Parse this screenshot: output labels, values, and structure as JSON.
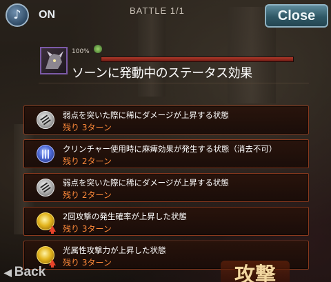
{
  "topbar": {
    "music_icon": "♪",
    "music_state": "ON",
    "battle_label": "BATTLE  1/1",
    "close_label": "Close"
  },
  "header": {
    "hp_percent": "100%",
    "hp_fraction": 1.0,
    "title": "ソーンに発動中のステータス効果"
  },
  "status_effects": [
    {
      "icon": "weakness-crit-icon",
      "description": "弱点を突いた際に稀にダメージが上昇する状態",
      "turns": "残り 3ターン"
    },
    {
      "icon": "paralysis-icon",
      "description": "クリンチャー使用時に麻痺効果が発生する状態（消去不可）",
      "turns": "残り 2ターン"
    },
    {
      "icon": "weakness-crit-icon",
      "description": "弱点を突いた際に稀にダメージが上昇する状態",
      "turns": "残り 2ターン"
    },
    {
      "icon": "double-attack-up-icon",
      "description": "2回攻撃の発生確率が上昇した状態",
      "turns": "残り 3ターン"
    },
    {
      "icon": "light-attack-up-icon",
      "description": "光属性攻撃力が上昇した状態",
      "turns": "残り 3ターン"
    }
  ],
  "bottom": {
    "back_label": "Back",
    "attack_label": "攻撃"
  },
  "colors": {
    "turns_text": "#ff8a3a",
    "item_border": "#8a3a1e",
    "close_button": "#2f5866"
  }
}
